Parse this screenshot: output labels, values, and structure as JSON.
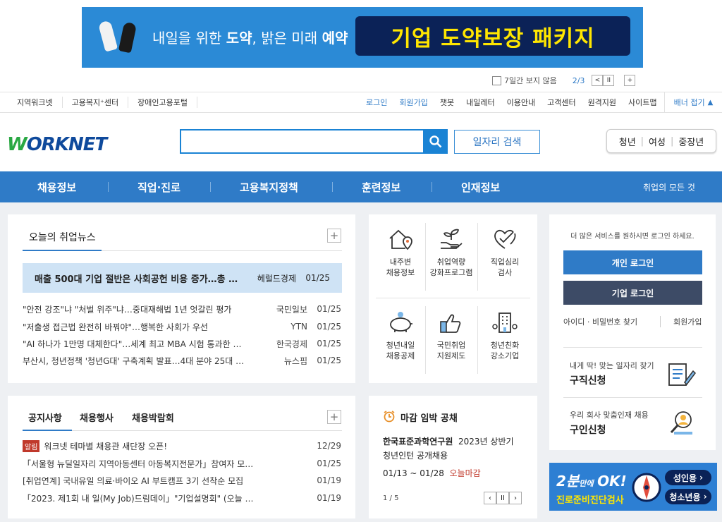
{
  "banner": {
    "slogan_pre": "내일을 위한 ",
    "slogan_b1": "도약",
    "slogan_mid": ", 밝은 미래 ",
    "slogan_b2": "예약",
    "package": "기업 도약보장 패키지"
  },
  "banner_ctl": {
    "hide7": "7일간 보지 않음",
    "page": "2/3",
    "prev": "<",
    "pause": "II",
    "next": "+"
  },
  "util_left": [
    "지역워크넷",
    "고용복지⁺센터",
    "장애인고용포털"
  ],
  "util_right": [
    "로그인",
    "회원가입",
    "챗봇",
    "내일레터",
    "이용안내",
    "고객센터",
    "원격지원",
    "사이트맵"
  ],
  "banner_fold": "배너 접기",
  "logo": {
    "w": "W",
    "rest": "ORKNET"
  },
  "search": {
    "button": "일자리 검색"
  },
  "segments": [
    "청년",
    "여성",
    "중장년"
  ],
  "nav": [
    "채용정보",
    "직업·진로",
    "고용복지정책",
    "훈련정보",
    "인재정보"
  ],
  "nav_right": "취업의 모든 것",
  "news": {
    "title": "오늘의 취업뉴스",
    "headline": {
      "text": "매출 500대 기업 절반은 사회공헌 비용 증가…총 …",
      "source": "헤럴드경제",
      "date": "01/25"
    },
    "items": [
      {
        "text": "\"안전 강조\"냐 \"처벌 위주\"냐…중대재해법 1년 엇갈린 평가",
        "source": "국민일보",
        "date": "01/25"
      },
      {
        "text": "\"저출생 접근법 완전히 바꿔야\"…행복한 사회가 우선",
        "source": "YTN",
        "date": "01/25"
      },
      {
        "text": "\"AI 하나가 1만명 대체한다\"…세계 최고 MBA 시험 통과한 …",
        "source": "한국경제",
        "date": "01/25"
      },
      {
        "text": "부산시, 청년정책 '청년G대' 구축계획 발표…4대 분야 25대 …",
        "source": "뉴스핌",
        "date": "01/25"
      }
    ]
  },
  "services": [
    {
      "l1": "내주변",
      "l2": "채용정보"
    },
    {
      "l1": "취업역량",
      "l2": "강화프로그램"
    },
    {
      "l1": "직업심리",
      "l2": "검사"
    },
    {
      "l1": "청년내일",
      "l2": "채용공제"
    },
    {
      "l1": "국민취업",
      "l2": "지원제도"
    },
    {
      "l1": "청년친화",
      "l2": "강소기업"
    }
  ],
  "login": {
    "msg": "더 많은 서비스를 원하시면 로그인 하세요.",
    "personal": "개인 로그인",
    "company": "기업 로그인",
    "find": "아이디 · 비밀번호 찾기",
    "join": "회원가입",
    "seek_small": "내게 딱! 맞는 일자리 찾기",
    "seek": "구직신청",
    "hire_small": "우리 회사 맞춤인재 채용",
    "hire": "구인신청"
  },
  "notice": {
    "tabs": [
      "공지사항",
      "채용행사",
      "채용박람회"
    ],
    "badge": "알림",
    "items": [
      {
        "text": "워크넷 테마별 채용관 새단장 오픈!",
        "date": "12/29"
      },
      {
        "text": "「서울형 뉴딜일자리 지역아동센터 아동복지전문가」참여자 모…",
        "date": "01/25"
      },
      {
        "text": "[취업연계] 국내유일 의료·바이오 AI 부트캠프 3기 선착순 모집",
        "date": "01/19"
      },
      {
        "text": "「2023. 제1회 내 일(My Job)드림데이」\"기업설명회\" (오늘 …",
        "date": "01/19"
      }
    ]
  },
  "deadline": {
    "title": "마감 임박 공채",
    "org": "한국표준과학연구원",
    "desc1": "2023년 상반기",
    "desc2": "청년인턴 공개채용",
    "period": "01/13 ~ 01/28",
    "status": "오늘마감",
    "page": "1 / 5"
  },
  "ad": {
    "big": "2분",
    "small": "만에",
    "ok": "OK!",
    "sub": "진로준비진단검사",
    "adult": "성인용",
    "youth": "청소년용"
  },
  "colors": {
    "primary": "#2f7bc7",
    "dark": "#3d4b66",
    "accent": "#1a83d4",
    "alert": "#c0392b"
  }
}
